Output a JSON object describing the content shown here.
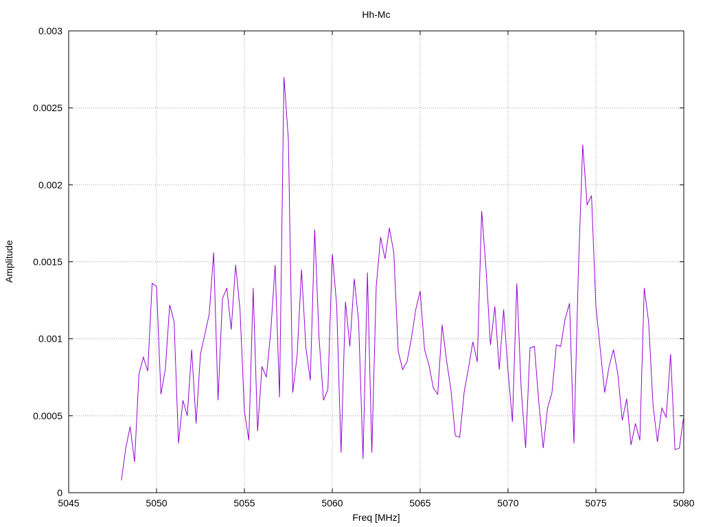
{
  "chart_data": {
    "type": "line",
    "title": "Hh-Mc",
    "xlabel": "Freq [MHz]",
    "ylabel": "Amplitude",
    "xlim": [
      5045,
      5080
    ],
    "ylim": [
      0,
      0.003
    ],
    "grid": true,
    "x_ticks": [
      5045,
      5050,
      5055,
      5060,
      5065,
      5070,
      5075,
      5080
    ],
    "x_tick_labels": [
      "5045",
      "5050",
      "5055",
      "5060",
      "5065",
      "5070",
      "5075",
      "5080"
    ],
    "y_ticks": [
      0,
      0.0005,
      0.001,
      0.0015,
      0.002,
      0.0025,
      0.003
    ],
    "y_tick_labels": [
      "0",
      "0.0005",
      "0.001",
      "0.0015",
      "0.002",
      "0.0025",
      "0.003"
    ],
    "series_color": "#9400d3",
    "series": [
      {
        "x": [
          5048.0,
          5048.25,
          5048.5,
          5048.75,
          5049.0,
          5049.25,
          5049.5,
          5049.75,
          5050.0,
          5050.25,
          5050.5,
          5050.75,
          5051.0,
          5051.25,
          5051.5,
          5051.75,
          5052.0,
          5052.25,
          5052.5,
          5052.75,
          5053.0,
          5053.25,
          5053.5,
          5053.75,
          5054.0,
          5054.25,
          5054.5,
          5054.75,
          5055.0,
          5055.25,
          5055.5,
          5055.75,
          5056.0,
          5056.25,
          5056.5,
          5056.75,
          5057.0,
          5057.25,
          5057.5,
          5057.75,
          5058.0,
          5058.25,
          5058.5,
          5058.75,
          5059.0,
          5059.25,
          5059.5,
          5059.75,
          5060.0,
          5060.25,
          5060.5,
          5060.75,
          5061.0,
          5061.25,
          5061.5,
          5061.75,
          5062.0,
          5062.25,
          5062.5,
          5062.75,
          5063.0,
          5063.25,
          5063.5,
          5063.75,
          5064.0,
          5064.25,
          5064.5,
          5064.75,
          5065.0,
          5065.25,
          5065.5,
          5065.75,
          5066.0,
          5066.25,
          5066.5,
          5066.75,
          5067.0,
          5067.25,
          5067.5,
          5067.75,
          5068.0,
          5068.25,
          5068.5,
          5068.75,
          5069.0,
          5069.25,
          5069.5,
          5069.75,
          5070.0,
          5070.25,
          5070.5,
          5070.75,
          5071.0,
          5071.25,
          5071.5,
          5071.75,
          5072.0,
          5072.25,
          5072.5,
          5072.75,
          5073.0,
          5073.25,
          5073.5,
          5073.75,
          5074.0,
          5074.25,
          5074.5,
          5074.75,
          5075.0,
          5075.25,
          5075.5,
          5075.75,
          5076.0,
          5076.25,
          5076.5,
          5076.75,
          5077.0,
          5077.25,
          5077.5,
          5077.75,
          5078.0,
          5078.25,
          5078.5,
          5078.75,
          5079.0,
          5079.25,
          5079.5,
          5079.75,
          5080.0
        ],
        "y": [
          8e-05,
          0.00029,
          0.00043,
          0.0002,
          0.00077,
          0.00088,
          0.00079,
          0.00136,
          0.00134,
          0.00064,
          0.0008,
          0.00122,
          0.00111,
          0.00032,
          0.0006,
          0.0005,
          0.00093,
          0.00045,
          0.0009,
          0.00103,
          0.00116,
          0.00156,
          0.0006,
          0.00126,
          0.00133,
          0.00106,
          0.00148,
          0.00119,
          0.00053,
          0.00034,
          0.00133,
          0.0004,
          0.00082,
          0.00075,
          0.00105,
          0.00148,
          0.00062,
          0.0027,
          0.0023,
          0.00065,
          0.00089,
          0.00145,
          0.00094,
          0.00073,
          0.00171,
          0.001,
          0.0006,
          0.00067,
          0.00155,
          0.00122,
          0.00026,
          0.00124,
          0.00095,
          0.00139,
          0.00111,
          0.00022,
          0.00143,
          0.00026,
          0.00134,
          0.00166,
          0.00152,
          0.00172,
          0.00156,
          0.00092,
          0.0008,
          0.00085,
          0.001,
          0.00119,
          0.00131,
          0.00093,
          0.00083,
          0.00068,
          0.00064,
          0.00109,
          0.00086,
          0.00067,
          0.00037,
          0.00036,
          0.00065,
          0.00081,
          0.00098,
          0.00085,
          0.00183,
          0.00145,
          0.00096,
          0.00121,
          0.0008,
          0.00119,
          0.00079,
          0.00046,
          0.00136,
          0.00067,
          0.00029,
          0.00094,
          0.00095,
          0.00059,
          0.00029,
          0.00055,
          0.00065,
          0.00096,
          0.00095,
          0.00113,
          0.00123,
          0.00032,
          0.00143,
          0.00226,
          0.00187,
          0.00193,
          0.00121,
          0.00093,
          0.00065,
          0.00082,
          0.00093,
          0.00077,
          0.00047,
          0.00061,
          0.00031,
          0.00045,
          0.00034,
          0.00133,
          0.00111,
          0.00057,
          0.00033,
          0.00055,
          0.00049,
          0.0009,
          0.00028,
          0.00029,
          0.0005
        ]
      }
    ]
  }
}
